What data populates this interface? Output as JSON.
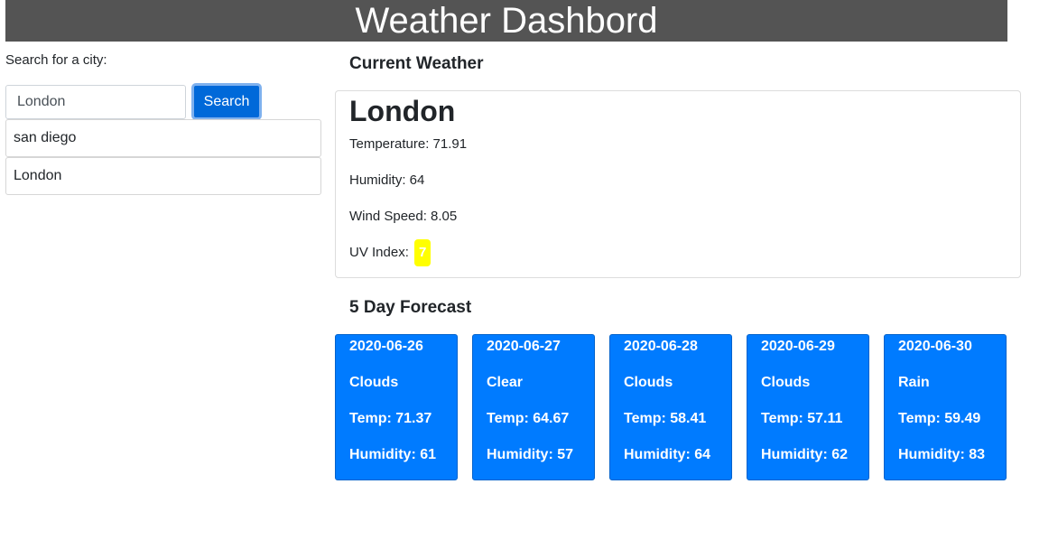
{
  "header": {
    "title": "Weather Dashbord"
  },
  "search": {
    "label": "Search for a city:",
    "value": "London",
    "button_label": "Search"
  },
  "history": [
    "san diego",
    "London"
  ],
  "current": {
    "section_title": "Current Weather",
    "city": "London",
    "temperature": "Temperature: 71.91",
    "humidity": "Humidity: 64",
    "wind_speed": "Wind Speed: 8.05",
    "uv_label": "UV Index:",
    "uv_value": "7",
    "uv_color": "#ffff00"
  },
  "forecast": {
    "section_title": "5 Day Forecast",
    "accent_color": "#007bff",
    "days": [
      {
        "date": "2020-06-26",
        "condition": "Clouds",
        "temp": "Temp: 71.37",
        "humidity": "Humidity: 61"
      },
      {
        "date": "2020-06-27",
        "condition": "Clear",
        "temp": "Temp: 64.67",
        "humidity": "Humidity: 57"
      },
      {
        "date": "2020-06-28",
        "condition": "Clouds",
        "temp": "Temp: 58.41",
        "humidity": "Humidity: 64"
      },
      {
        "date": "2020-06-29",
        "condition": "Clouds",
        "temp": "Temp: 57.11",
        "humidity": "Humidity: 62"
      },
      {
        "date": "2020-06-30",
        "condition": "Rain",
        "temp": "Temp: 59.49",
        "humidity": "Humidity: 83"
      }
    ]
  }
}
